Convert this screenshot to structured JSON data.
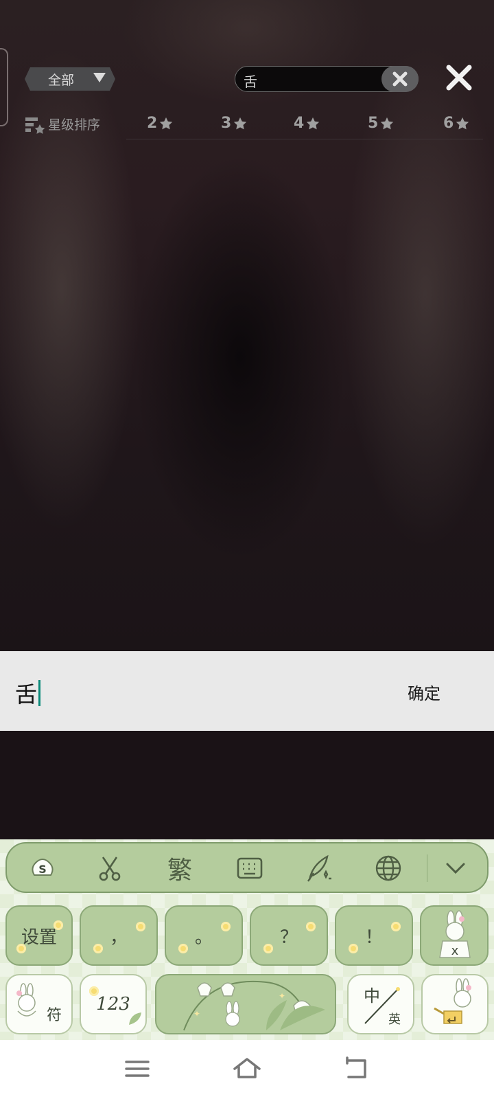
{
  "game": {
    "filter_label": "全部",
    "search_value": "舌",
    "sort_label": "星级排序",
    "star_filters": [
      "2",
      "3",
      "4",
      "5",
      "6"
    ]
  },
  "ime": {
    "composing_text": "舌",
    "confirm_label": "确定"
  },
  "keyboard": {
    "toolbar": {
      "traditional_label": "繁",
      "icons": [
        "sogou-logo-icon",
        "scissors-icon",
        "keyboard-icon",
        "handwriting-quill-icon",
        "globe-icon",
        "collapse-chevron-icon"
      ]
    },
    "row1": [
      "设置",
      "，",
      "。",
      "？",
      "！"
    ],
    "row2": {
      "symbols_label": "符",
      "numbers_label": "123",
      "lang_top": "中",
      "lang_bottom": "英"
    }
  },
  "colors": {
    "keyboard_green": "#b4cc9d",
    "caret": "#0a8a7a",
    "ime_bar": "#e9e9e9"
  }
}
